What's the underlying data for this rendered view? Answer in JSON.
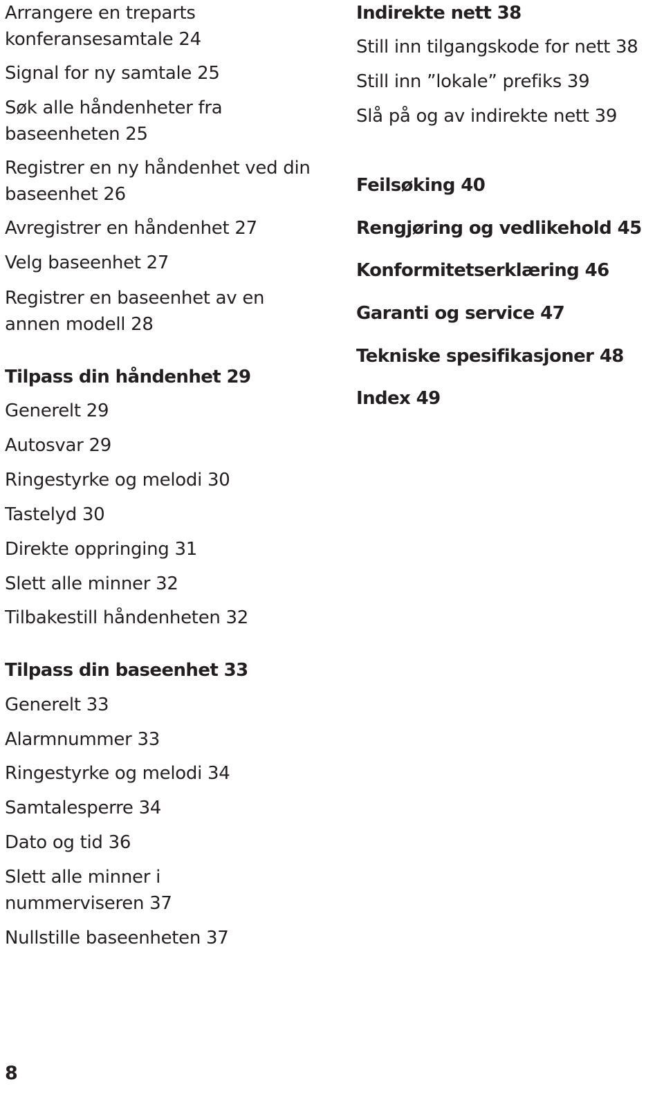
{
  "toc": {
    "left_column": [
      {
        "lines": [
          "Arrangere en treparts",
          "konferansesamtale  24"
        ],
        "bold": false
      },
      {
        "lines": [
          "Signal for ny samtale 25"
        ],
        "bold": false
      },
      {
        "lines": [
          "Søk alle håndenheter fra",
          "baseenheten 25"
        ],
        "bold": false
      },
      {
        "lines": [
          "Registrer en ny håndenhet ved din",
          "baseenhet  26"
        ],
        "bold": false
      },
      {
        "lines": [
          "Avregistrer en håndenhet 27"
        ],
        "bold": false
      },
      {
        "lines": [
          "Velg baseenhet 27"
        ],
        "bold": false
      },
      {
        "lines": [
          "Registrer en baseenhet av en",
          "annen modell 28"
        ],
        "bold": false
      },
      {
        "lines": [
          "Tilpass din håndenhet  29"
        ],
        "bold": true
      },
      {
        "lines": [
          "Generelt 29"
        ],
        "bold": false
      },
      {
        "lines": [
          "Autosvar 29"
        ],
        "bold": false
      },
      {
        "lines": [
          "Ringestyrke og melodi 30"
        ],
        "bold": false
      },
      {
        "lines": [
          "Tastelyd 30"
        ],
        "bold": false
      },
      {
        "lines": [
          "Direkte oppringing 31"
        ],
        "bold": false
      },
      {
        "lines": [
          "Slett alle minner 32"
        ],
        "bold": false
      },
      {
        "lines": [
          "Tilbakestill håndenheten 32"
        ],
        "bold": false
      },
      {
        "lines": [
          "Tilpass din baseenhet 33"
        ],
        "bold": true
      },
      {
        "lines": [
          "Generelt 33"
        ],
        "bold": false
      },
      {
        "lines": [
          "Alarmnummer  33"
        ],
        "bold": false
      },
      {
        "lines": [
          "Ringestyrke og melodi 34"
        ],
        "bold": false
      },
      {
        "lines": [
          "Samtalesperre 34"
        ],
        "bold": false
      },
      {
        "lines": [
          "Dato og tid  36"
        ],
        "bold": false
      },
      {
        "lines": [
          "Slett alle minner i",
          "nummerviseren 37"
        ],
        "bold": false
      },
      {
        "lines": [
          "Nullstille baseenheten 37"
        ],
        "bold": false
      }
    ],
    "right_column": [
      {
        "lines": [
          "Indirekte nett  38"
        ],
        "bold": true
      },
      {
        "lines": [
          "Still inn tilgangskode for nett 38"
        ],
        "bold": false
      },
      {
        "lines": [
          "Still inn ”lokale” prefiks 39"
        ],
        "bold": false
      },
      {
        "lines": [
          "Slå på og av indirekte nett  39"
        ],
        "bold": false
      },
      {
        "lines": [
          "Feilsøking 40"
        ],
        "bold": true
      },
      {
        "lines": [
          "Rengjøring og vedlikehold  45"
        ],
        "bold": true
      },
      {
        "lines": [
          "Konformitetserklæring  46"
        ],
        "bold": true
      },
      {
        "lines": [
          "Garanti og service 47"
        ],
        "bold": true
      },
      {
        "lines": [
          "Tekniske spesifikasjoner 48"
        ],
        "bold": true
      },
      {
        "lines": [
          "Index 49"
        ],
        "bold": true
      }
    ]
  },
  "footer": {
    "page_number": "8"
  }
}
